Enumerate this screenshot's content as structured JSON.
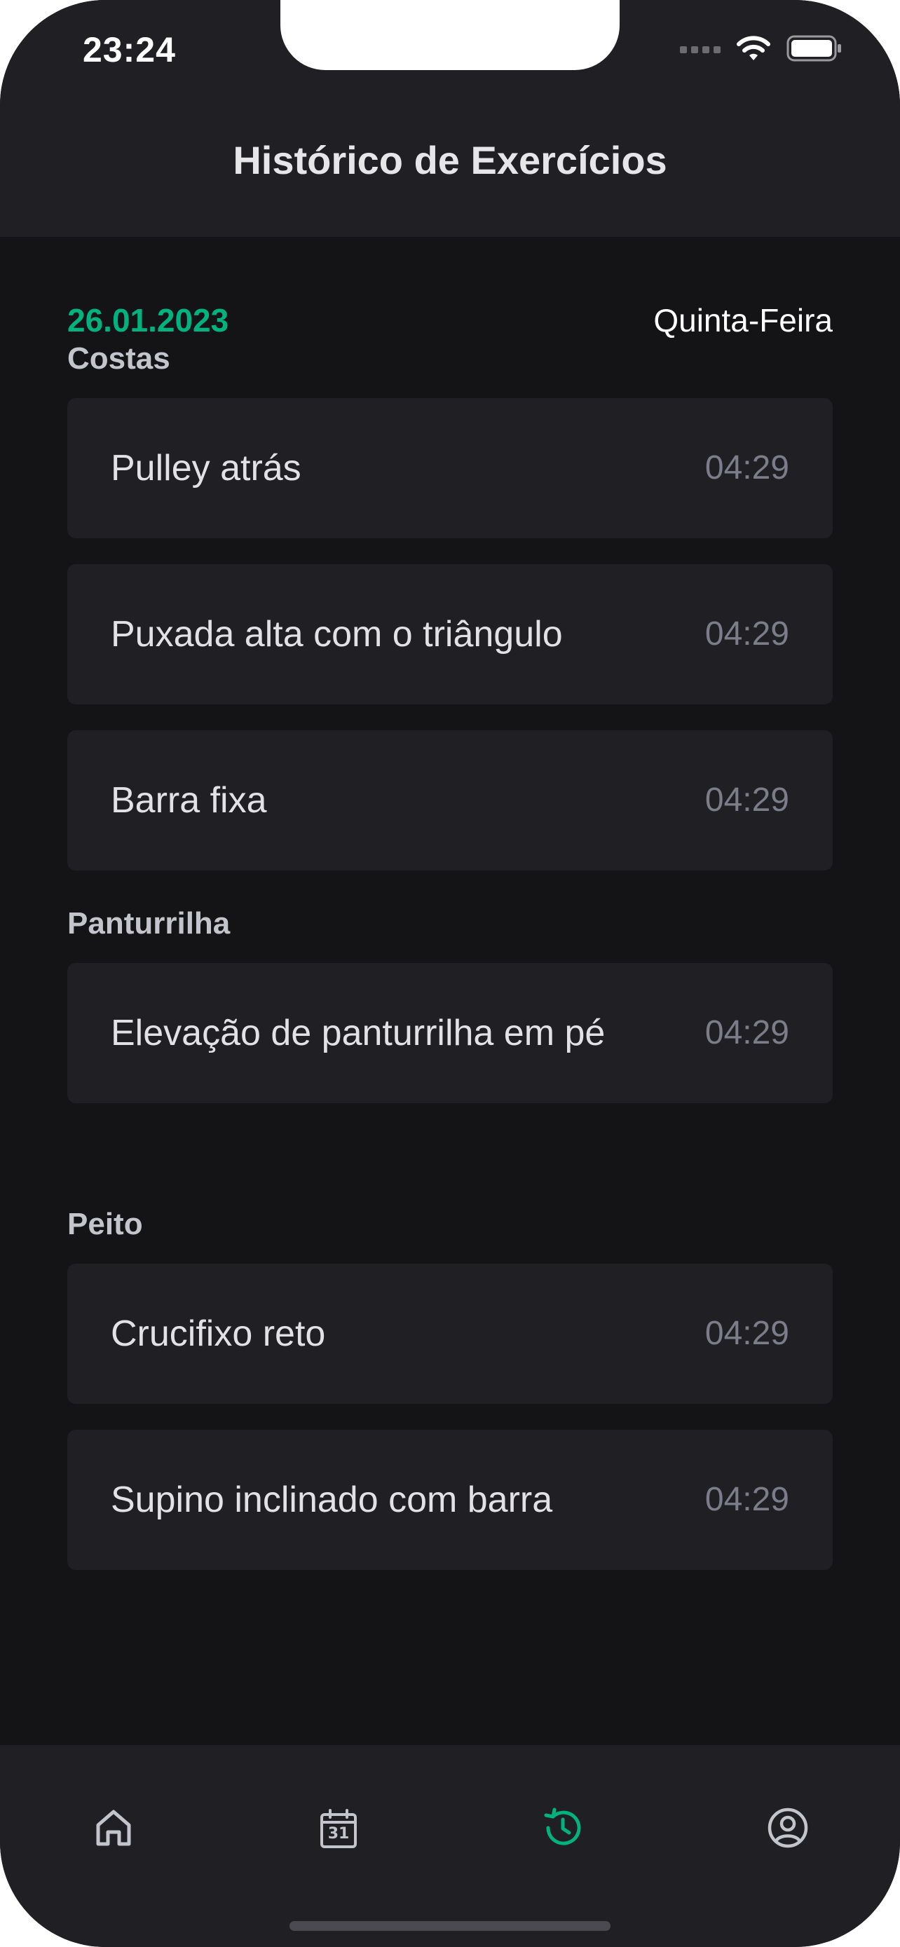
{
  "status_bar": {
    "time": "23:24",
    "icons": [
      "cellular-icon",
      "wifi-icon",
      "battery-icon"
    ]
  },
  "header": {
    "title": "Histórico de Exercícios"
  },
  "day": {
    "date": "26.01.2023",
    "weekday": "Quinta-Feira"
  },
  "groups": [
    {
      "title": "Costas",
      "items": [
        {
          "name": "Pulley atrás",
          "time": "04:29"
        },
        {
          "name": "Puxada alta com o triângulo",
          "time": "04:29"
        },
        {
          "name": "Barra fixa",
          "time": "04:29"
        }
      ]
    },
    {
      "title": "Panturrilha",
      "items": [
        {
          "name": "Elevação de panturrilha em pé",
          "time": "04:29"
        }
      ]
    },
    {
      "title": "Peito",
      "items": [
        {
          "name": "Crucifixo reto",
          "time": "04:29"
        },
        {
          "name": "Supino inclinado com barra",
          "time": "04:29"
        }
      ]
    }
  ],
  "tabbar": {
    "calendar_day": "31",
    "tabs": [
      {
        "icon": "home-icon",
        "active": false
      },
      {
        "icon": "calendar-icon",
        "active": false
      },
      {
        "icon": "history-icon",
        "active": true
      },
      {
        "icon": "profile-icon",
        "active": false
      }
    ]
  },
  "colors": {
    "accent": "#00b37e",
    "background": "#141416",
    "surface": "#202024",
    "text_primary": "#e1e1e6",
    "text_secondary": "#7c7c8a",
    "icon_inactive": "#c4c4cc"
  }
}
